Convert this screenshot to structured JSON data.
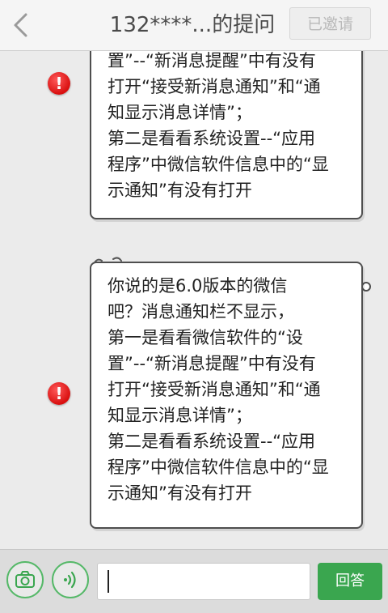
{
  "header": {
    "title": "132****...的提问",
    "invite_label": "已邀请"
  },
  "messages": [
    {
      "lines": [
        "置”--“新消息提醒”中有没有",
        "打开“接受新消息通知”和“通",
        "知显示消息详情”；",
        "第二是看看系统设置--“应用",
        "程序”中微信软件信息中的“显",
        "示通知”有没有打开"
      ],
      "status_icon": "error-icon",
      "status_symbol": "!"
    },
    {
      "lines": [
        "你说的是6.0版本的微信",
        "吧？消息通知栏不显示，",
        "第一是看看微信软件的“设",
        "置”--“新消息提醒”中有没有",
        "打开“接受新消息通知”和“通",
        "知显示消息详情”；",
        "第二是看看系统设置--“应用",
        "程序”中微信软件信息中的“显",
        "示通知”有没有打开"
      ],
      "status_icon": "error-icon",
      "status_symbol": "!"
    }
  ],
  "toolbar": {
    "camera_icon": "camera-icon",
    "voice_icon": "voice-icon",
    "answer_input_value": "",
    "answer_label": "回答"
  },
  "colors": {
    "accent_green": "#3aa64f",
    "error_red": "#e01818",
    "bubble_border": "#4e4e4e",
    "background": "#ebebeb"
  }
}
